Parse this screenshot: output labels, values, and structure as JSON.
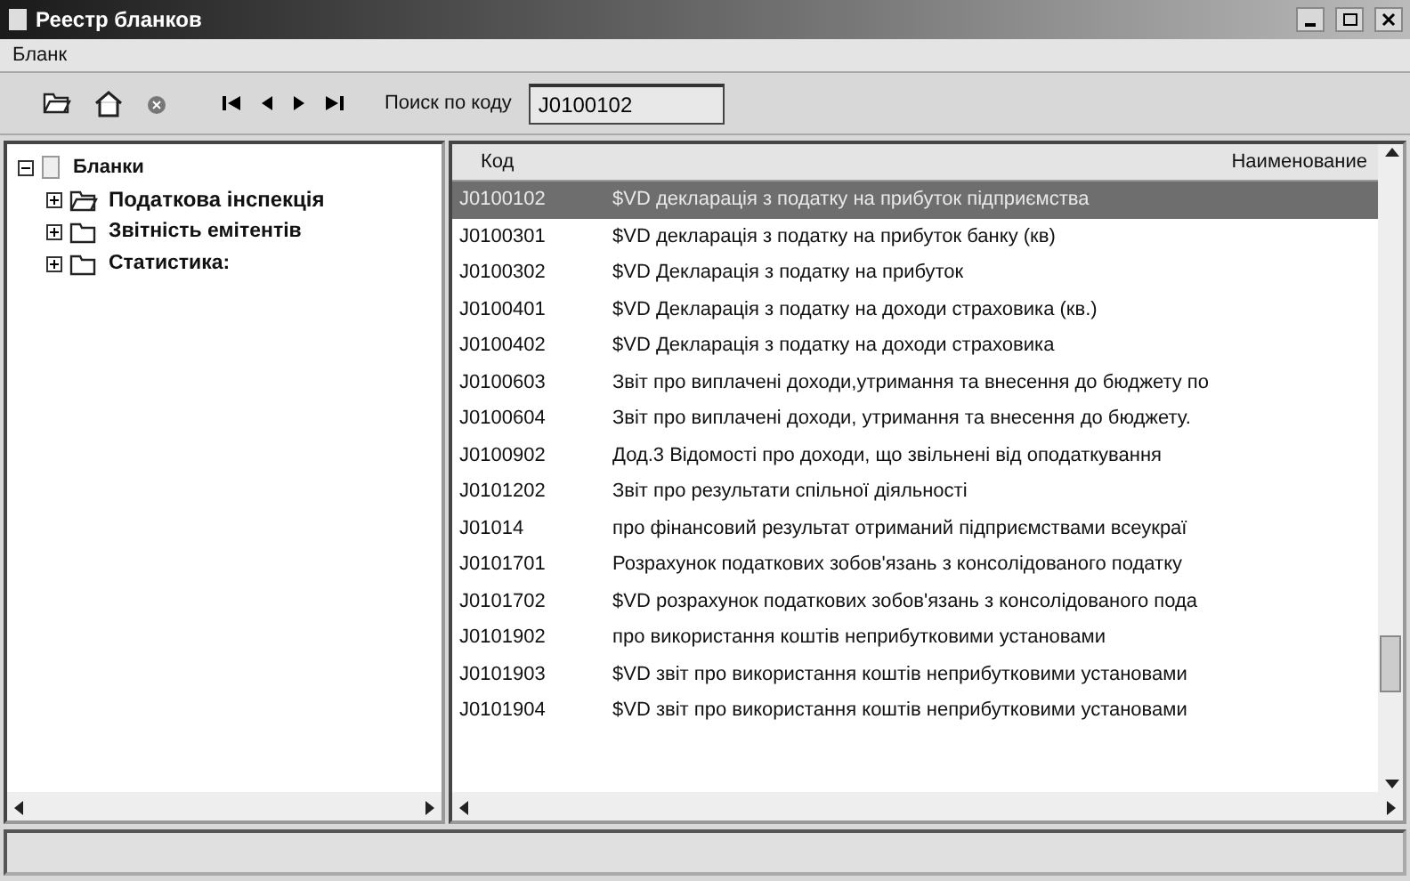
{
  "window": {
    "title": "Реестр бланков"
  },
  "menu": [
    "Бланк"
  ],
  "search": {
    "label": "Поиск по коду",
    "value": "J0100102"
  },
  "tree": {
    "label": "Бланки",
    "expanded": true,
    "children": [
      {
        "label": "Податкова інспекція",
        "selected": true,
        "expanded": false
      },
      {
        "label": "Звітність емітентів",
        "selected": false,
        "expanded": false
      },
      {
        "label": "Статистика:",
        "selected": false,
        "expanded": false
      }
    ]
  },
  "table": {
    "columns": [
      "Код",
      "Наименование"
    ],
    "rows": [
      {
        "code": "J0100102",
        "name": "$VD декларація з податку на прибуток підприємства",
        "selected": true
      },
      {
        "code": "J0100301",
        "name": "$VD декларація з податку на прибуток банку (кв)",
        "selected": false
      },
      {
        "code": "J0100302",
        "name": "$VD Декларація з податку на прибуток",
        "selected": false
      },
      {
        "code": "J0100401",
        "name": "$VD Декларація з податку на доходи страховика (кв.)",
        "selected": false
      },
      {
        "code": "J0100402",
        "name": "$VD Декларація з податку на доходи страховика",
        "selected": false
      },
      {
        "code": "J0100603",
        "name": "Звіт про виплачені доходи,утримання та внесення до бюджету по",
        "selected": false
      },
      {
        "code": "J0100604",
        "name": "Звіт про виплачені доходи, утримання та внесення до бюджету.",
        "selected": false
      },
      {
        "code": "J0100902",
        "name": "Дод.3 Відомості про доходи, що звільнені від оподаткування",
        "selected": false
      },
      {
        "code": "J0101202",
        "name": "Звіт про результати спільної діяльності",
        "selected": false
      },
      {
        "code": "J01014",
        "name": "про фінансовий результат отриманий підприємствами всеукраї",
        "selected": false
      },
      {
        "code": "J0101701",
        "name": "Розрахунок податкових зобов'язань з консолідованого податку",
        "selected": false
      },
      {
        "code": "J0101702",
        "name": "$VD розрахунок податкових зобов'язань з консолідованого пода",
        "selected": false
      },
      {
        "code": "J0101902",
        "name": "про використання коштів неприбутковими установами",
        "selected": false
      },
      {
        "code": "J0101903",
        "name": "$VD звіт про використання коштів неприбутковими установами",
        "selected": false
      },
      {
        "code": "J0101904",
        "name": "$VD звіт про використання коштів неприбутковими установами",
        "selected": false
      }
    ]
  }
}
